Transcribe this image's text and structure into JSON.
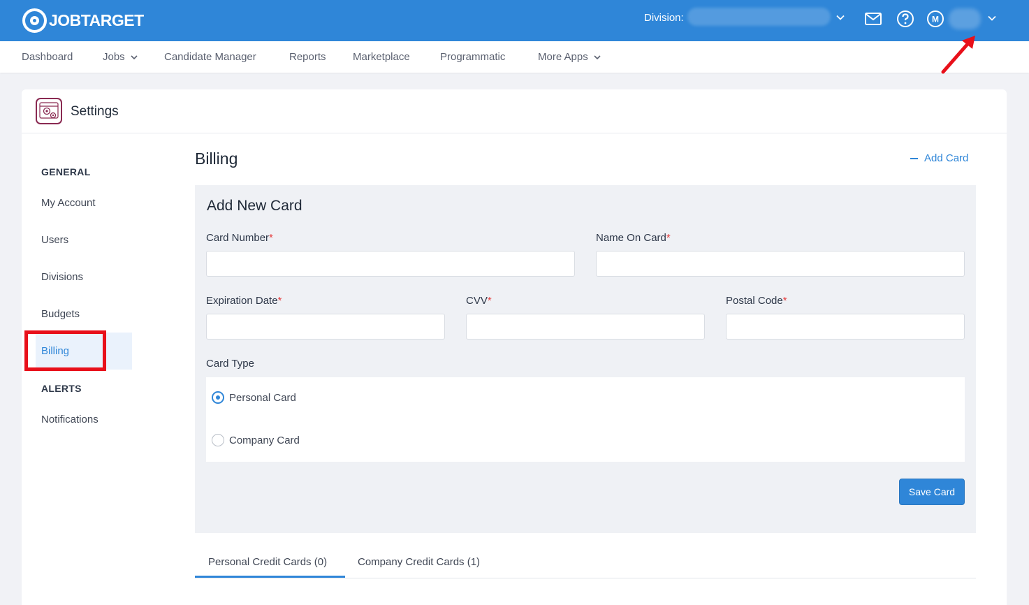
{
  "app": {
    "logo_text": "JOBTARGET",
    "division_label": "Division:",
    "user_initial": "M"
  },
  "nav": {
    "items": [
      {
        "label": "Dashboard",
        "has_dropdown": false
      },
      {
        "label": "Jobs",
        "has_dropdown": true
      },
      {
        "label": "Candidate Manager",
        "has_dropdown": false
      },
      {
        "label": "Reports",
        "has_dropdown": false
      },
      {
        "label": "Marketplace",
        "has_dropdown": false
      },
      {
        "label": "Programmatic",
        "has_dropdown": false
      },
      {
        "label": "More Apps",
        "has_dropdown": true
      }
    ]
  },
  "settings": {
    "title": "Settings"
  },
  "sidebar": {
    "general_heading": "GENERAL",
    "items": [
      {
        "label": "My Account"
      },
      {
        "label": "Users"
      },
      {
        "label": "Divisions"
      },
      {
        "label": "Budgets"
      },
      {
        "label": "Billing",
        "active": true
      }
    ],
    "alerts_heading": "ALERTS",
    "alerts_items": [
      {
        "label": "Notifications"
      }
    ]
  },
  "billing": {
    "title": "Billing",
    "add_card_link": "Add Card",
    "form": {
      "title": "Add New Card",
      "card_number_label": "Card Number",
      "name_on_card_label": "Name On Card",
      "expiration_label": "Expiration Date",
      "cvv_label": "CVV",
      "postal_label": "Postal Code",
      "required_mark": "*",
      "card_type_label": "Card Type",
      "card_types": [
        {
          "label": "Personal Card",
          "selected": true
        },
        {
          "label": "Company Card",
          "selected": false
        }
      ],
      "values": {
        "card_number": "",
        "name_on_card": "",
        "expiration": "",
        "cvv": "",
        "postal": ""
      },
      "save_label": "Save Card"
    },
    "tabs": [
      {
        "label": "Personal Credit Cards (0)",
        "active": true
      },
      {
        "label": "Company Credit Cards (1)",
        "active": false
      }
    ]
  },
  "colors": {
    "brand_blue": "#2f86d8",
    "highlight_red": "#e8101a"
  }
}
